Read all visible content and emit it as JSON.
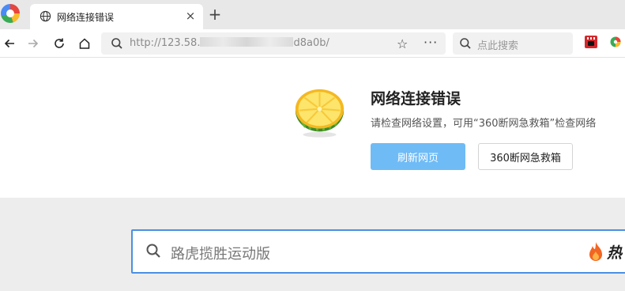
{
  "tab": {
    "title": "网络连接错误",
    "close": "×",
    "new_tab": "+"
  },
  "toolbar": {
    "url_visible_start": "http://123.58.",
    "url_visible_end": "d8a0b/",
    "star": "☆",
    "more": "···",
    "search_placeholder": "点此搜索"
  },
  "error": {
    "title": "网络连接错误",
    "description": "请检查网络设置，可用“360断网急救箱”检查网络",
    "refresh_label": "刷新网页",
    "rescue_label": "360断网急救箱"
  },
  "bottom_search": {
    "placeholder": "路虎揽胜运动版",
    "hot_label": "热"
  },
  "colors": {
    "accent": "#4a90e2",
    "refresh_button": "#6fbbf6",
    "tabstrip": "#e8e8e8",
    "lower_bg": "#ededed"
  }
}
